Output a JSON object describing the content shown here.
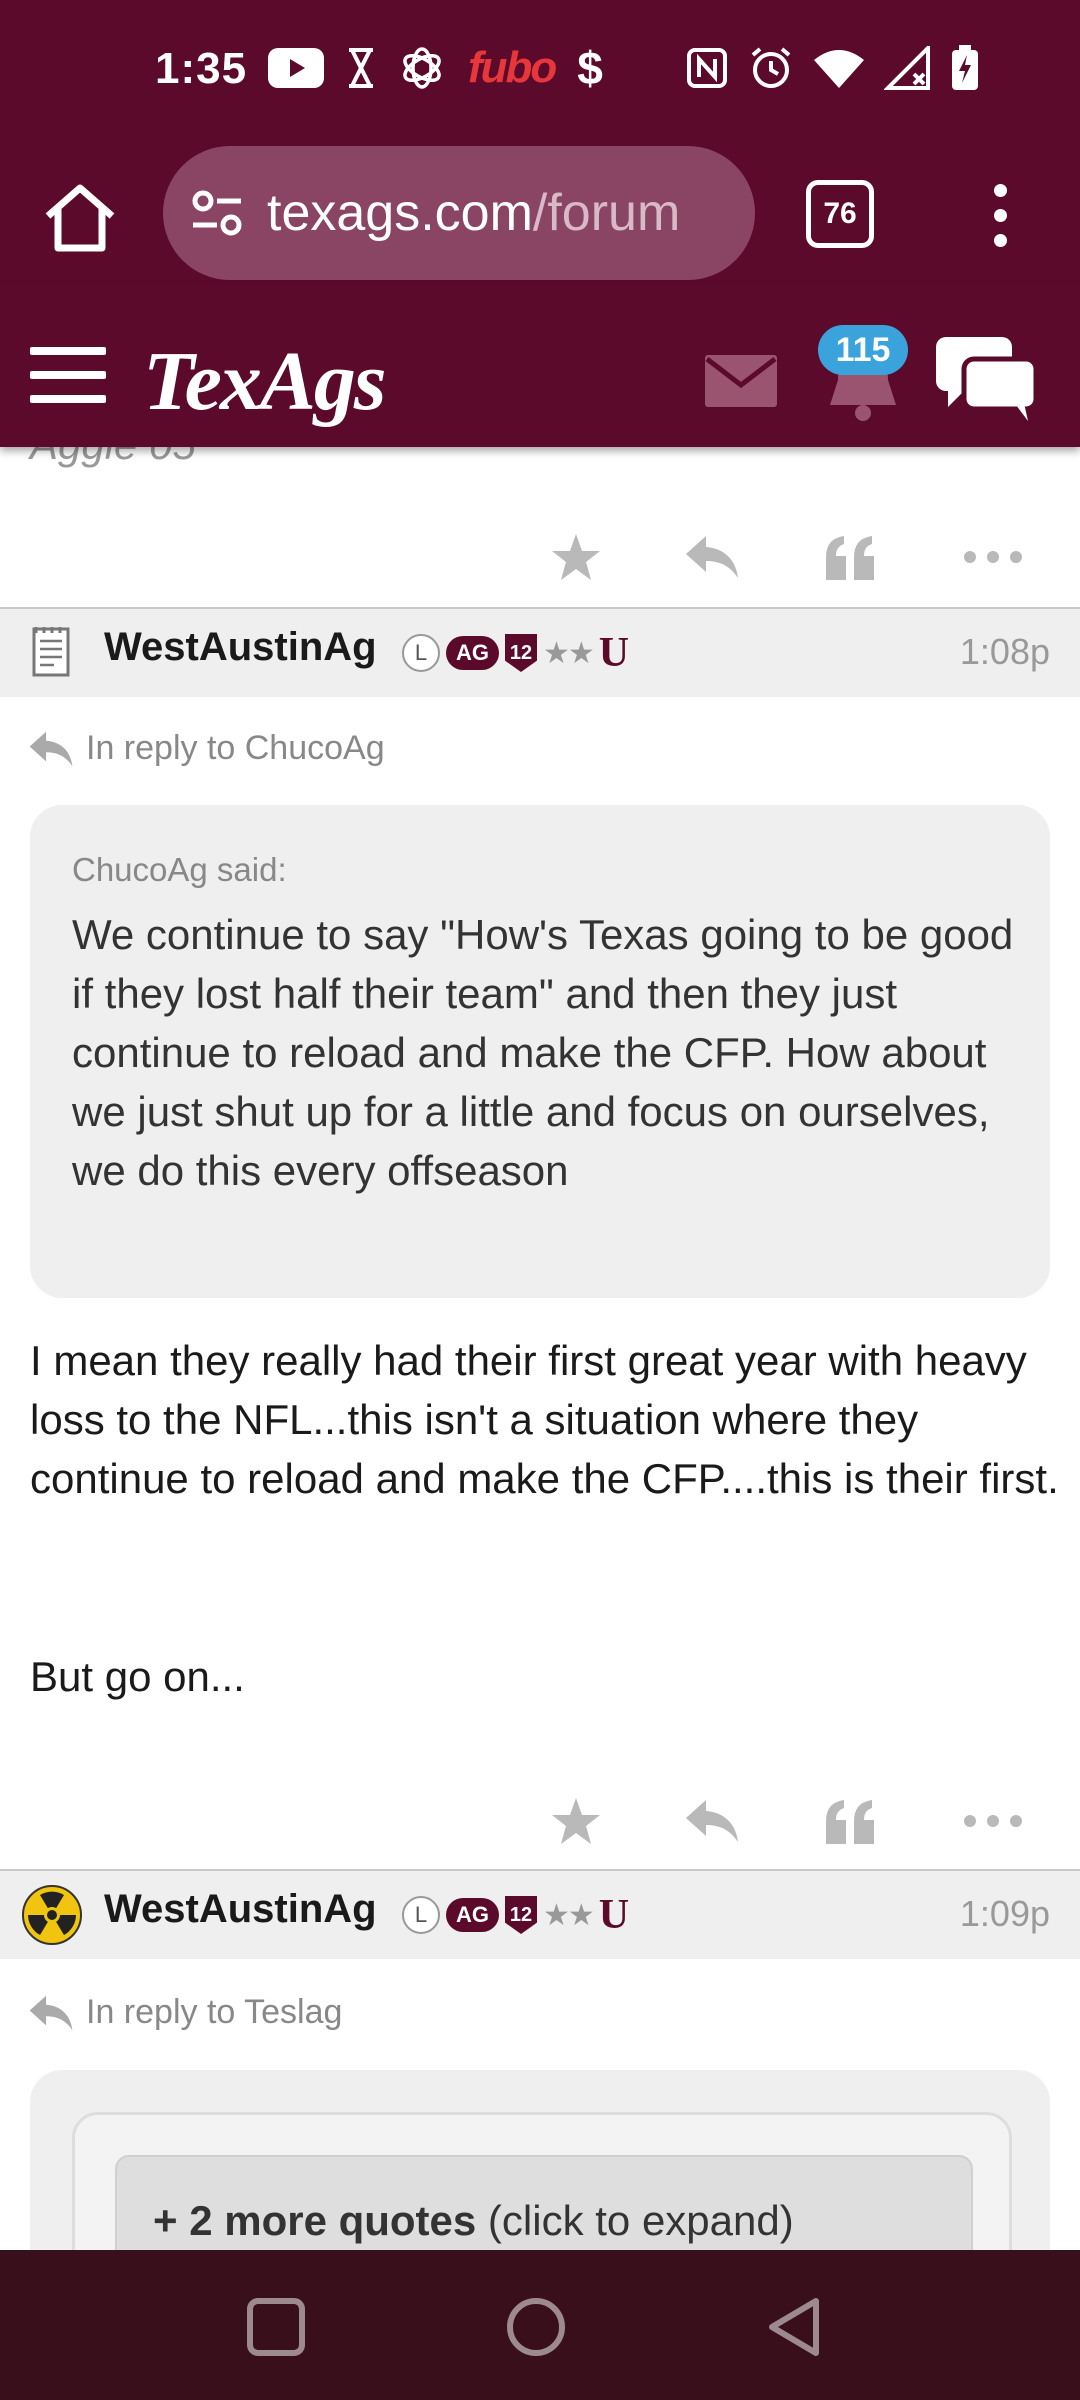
{
  "status_bar": {
    "time": "1:35",
    "left_icons": [
      "youtube-icon",
      "hourglass-icon",
      "openai-icon",
      "fubo-icon",
      "dollar-icon"
    ],
    "fubo_label": "fubo",
    "dollar_label": "$",
    "right_icons": [
      "nfc-icon",
      "alarm-icon",
      "wifi-icon",
      "signal-icon",
      "battery-charging-icon"
    ]
  },
  "browser": {
    "url_host": "texags.com",
    "url_path": "/forum",
    "tab_count": "76"
  },
  "site": {
    "logo": "TexAgs",
    "notification_count": "115",
    "colors": {
      "maroon": "#5c0a2b",
      "badge_blue": "#3ba3dc",
      "nav_dark": "#3a0f1c"
    }
  },
  "previous_post": {
    "author_partial": "Aggie 05"
  },
  "posts": [
    {
      "username": "WestAustinAg",
      "badge_l": "L",
      "badge_ag": "AG",
      "badge_12": "12",
      "badge_stars": "★★",
      "badge_u": "U",
      "time": "1:08p",
      "reply_to": "In reply to ChucoAg",
      "quote_author": "ChucoAg said:",
      "quote_text": "We continue to say \"How's Texas going to be good if they lost half their team\" and then they just continue to reload and make the CFP. How about we just shut up for a little and focus on ourselves, we do this every offseason",
      "body_p1": "I mean they really had their first great year with heavy loss to the NFL...this isn't a situation where they continue to reload and make the CFP....this is their first.",
      "body_p2": "But go on..."
    },
    {
      "username": "WestAustinAg",
      "badge_l": "L",
      "badge_ag": "AG",
      "badge_12": "12",
      "badge_stars": "★★",
      "badge_u": "U",
      "time": "1:09p",
      "reply_to": "In reply to Teslag",
      "more_quotes_bold": "+ 2 more quotes",
      "more_quotes_rest": " (click to expand)"
    }
  ]
}
